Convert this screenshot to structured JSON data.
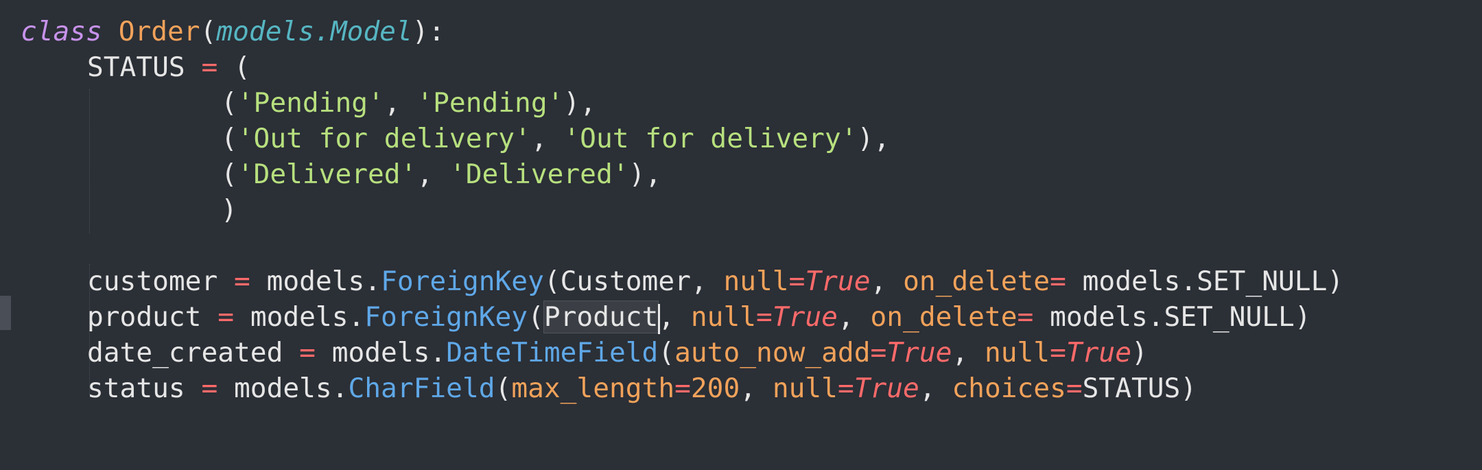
{
  "colors": {
    "background": "#2b2f36",
    "keyword": "#c792ea",
    "class_name": "#f2a25a",
    "base_class": "#56b6c2",
    "plain": "#e6e6e6",
    "operator": "#ff6a6a",
    "string": "#b7e07e",
    "method": "#5fa8e8",
    "parameter": "#f2a25a",
    "boolean": "#ff6a6a",
    "number": "#f2a25a"
  },
  "code": {
    "line1": {
      "kw": "class",
      "name": "Order",
      "paren_open": "(",
      "base": "models.Model",
      "tail": "):"
    },
    "line2": {
      "name": "STATUS",
      "eq": "=",
      "tail": "("
    },
    "line3": {
      "p1": "(",
      "s1": "'Pending'",
      "c": ", ",
      "s2": "'Pending'",
      "p2": "),"
    },
    "line4": {
      "p1": "(",
      "s1": "'Out for delivery'",
      "c": ", ",
      "s2": "'Out for delivery'",
      "p2": "),"
    },
    "line5": {
      "p1": "(",
      "s1": "'Delivered'",
      "c": ", ",
      "s2": "'Delivered'",
      "p2": "),"
    },
    "line6": {
      "p": ")"
    },
    "line8": {
      "name": "customer",
      "eq": "=",
      "obj": "models.",
      "method": "ForeignKey",
      "open": "(",
      "arg": "Customer",
      "c1": ", ",
      "k1": "null",
      "eq1": "=",
      "v1": "True",
      "c2": ", ",
      "k2": "on_delete",
      "eq2": "=",
      "v2": " models.SET_NULL",
      "close": ")"
    },
    "line9": {
      "name": "product",
      "eq": "=",
      "obj": "models.",
      "method": "ForeignKey",
      "open": "(",
      "arg": "Product",
      "c1": ", ",
      "k1": "null",
      "eq1": "=",
      "v1": "True",
      "c2": ", ",
      "k2": "on_delete",
      "eq2": "=",
      "v2": " models.SET_NULL",
      "close": ")"
    },
    "line10": {
      "name": "date_created",
      "eq": "=",
      "obj": "models.",
      "method": "DateTimeField",
      "open": "(",
      "k1": "auto_now_add",
      "eq1": "=",
      "v1": "True",
      "c1": ", ",
      "k2": "null",
      "eq2": "=",
      "v2": "True",
      "close": ")"
    },
    "line11": {
      "name": "status",
      "eq": "=",
      "obj": "models.",
      "method": "CharField",
      "open": "(",
      "k1": "max_length",
      "eq1": "=",
      "v1": "200",
      "c1": ", ",
      "k2": "null",
      "eq2": "=",
      "v2": "True",
      "c2": ", ",
      "k3": "choices",
      "eq3": "=",
      "v3": "STATUS",
      "close": ")"
    }
  }
}
